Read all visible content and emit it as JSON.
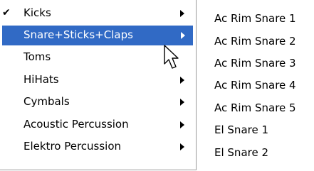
{
  "menu": {
    "items": [
      {
        "label": "Kicks",
        "checked": true,
        "has_submenu": true,
        "highlighted": false
      },
      {
        "label": "Snare+Sticks+Claps",
        "checked": false,
        "has_submenu": true,
        "highlighted": true
      },
      {
        "label": "Toms",
        "checked": false,
        "has_submenu": false,
        "highlighted": false
      },
      {
        "label": "HiHats",
        "checked": false,
        "has_submenu": true,
        "highlighted": false
      },
      {
        "label": "Cymbals",
        "checked": false,
        "has_submenu": true,
        "highlighted": false
      },
      {
        "label": "Acoustic Percussion",
        "checked": false,
        "has_submenu": true,
        "highlighted": false
      },
      {
        "label": "Elektro Percussion",
        "checked": false,
        "has_submenu": true,
        "highlighted": false
      }
    ],
    "check_glyph": "✔",
    "highlight_color": "#316ac5",
    "icons": {
      "check": "checkmark-icon",
      "submenu": "submenu-arrow-icon",
      "cursor": "mouse-pointer-icon"
    }
  },
  "submenu": {
    "items": [
      "Ac Rim Snare 1",
      "Ac Rim Snare 2",
      "Ac Rim Snare 3",
      "Ac Rim Snare 4",
      "Ac Rim Snare 5",
      "El Snare 1",
      "El Snare 2"
    ]
  }
}
